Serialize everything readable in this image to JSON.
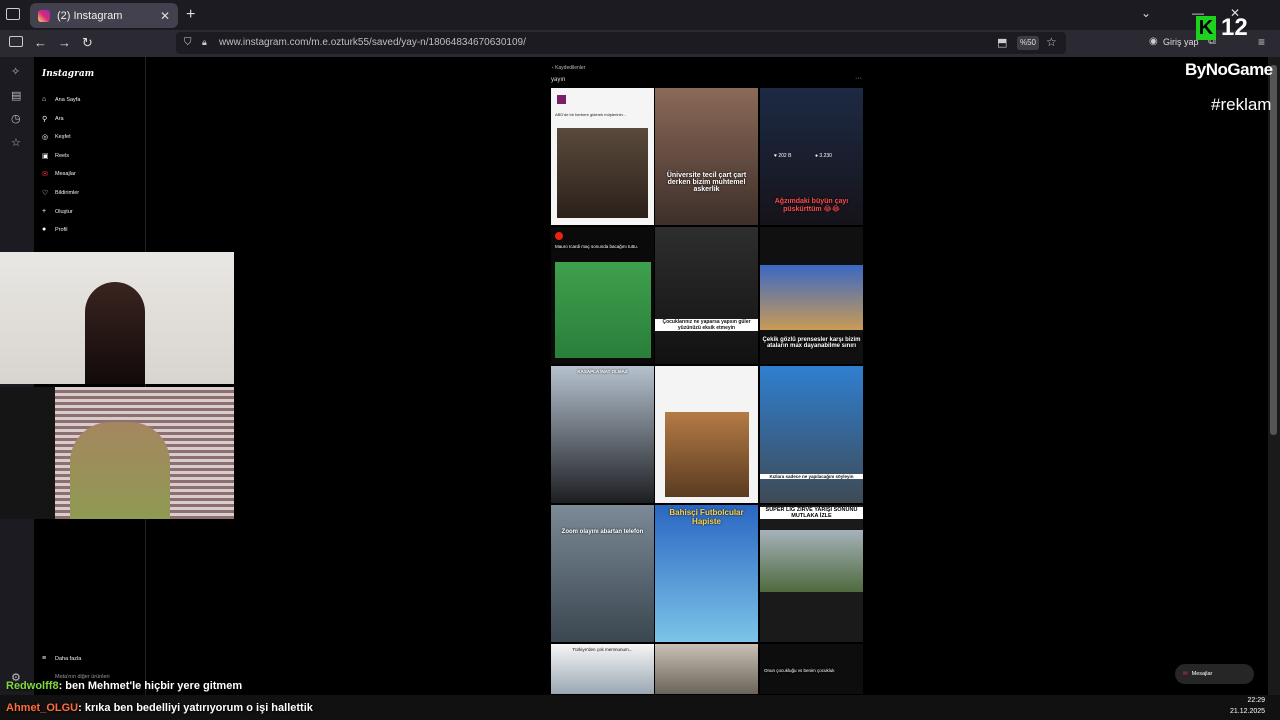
{
  "browser": {
    "tab_title": "(2) Instagram",
    "url": "www.instagram.com/m.e.ozturk55/saved/yay-n/18064834670630109/",
    "zoom": "%50",
    "login": "Giriş yap"
  },
  "instagram": {
    "logo": "Instagram",
    "nav": [
      {
        "icon": "home-icon",
        "label": "Ana Sayfa"
      },
      {
        "icon": "search-icon",
        "label": "Ara"
      },
      {
        "icon": "compass-icon",
        "label": "Keşfet"
      },
      {
        "icon": "reels-icon",
        "label": "Reels"
      },
      {
        "icon": "messages-icon",
        "label": "Mesajlar"
      },
      {
        "icon": "heart-icon",
        "label": "Bildirimler"
      },
      {
        "icon": "plus-icon",
        "label": "Oluştur"
      },
      {
        "icon": "profile-icon",
        "label": "Profil"
      }
    ],
    "more_label": "Daha fazla",
    "meta_label": "Meta'nın diğer ürünleri",
    "back_label": "Kaydedilenler",
    "collection_title": "yayın",
    "messages_button": "Mesajlar",
    "tiles": [
      {
        "caption": "ABD'de bir berbere giderek müşterinin..."
      },
      {
        "caption": "Üniversite tecil çart çart derken bizim muhtemel askerlik"
      },
      {
        "caption": "Ağzımdaki büyün çayı püskürttüm 😂😂",
        "stat1": "202 B",
        "stat2": "3.230"
      },
      {
        "caption": "Mauro Icardi maç sonunda bacağını tuttu."
      },
      {
        "caption": "Çocuklarınız ne yaparsa yapsın güler yüzünüzü eksik etmeyin"
      },
      {
        "caption": "Çekik gözlü prensesler karşı bizim ataların max dayanabilme sınırı"
      },
      {
        "caption": "KASAPLA İNAT OLMAZ"
      },
      {
        "caption": ""
      },
      {
        "caption": "Kızlara sadece ne yapılacağını söyleyin"
      },
      {
        "caption": "Zoom olayını abartan telefon"
      },
      {
        "caption": "Bahisçi Futbolcular Hapiste"
      },
      {
        "caption": "SÜPER LİG ZİRVE YARIŞI SONUNU MUTLAKA İZLE"
      },
      {
        "caption": "Türkiye'den çok memnunum..."
      },
      {
        "caption": ""
      },
      {
        "caption": "Onun çocukluğu vs benim çocukluk"
      }
    ]
  },
  "overlay": {
    "channel_number": "12",
    "brand": "ByNoGame",
    "ad_tag": "#reklam",
    "chat": [
      {
        "user": "Redwolff8",
        "text": ": ben Mehmet'le hiçbir yere gitmem"
      },
      {
        "user": "Ahmet_OLGU",
        "text": ": krıka ben bedelliyi yatırıyorum o işi hallettik"
      }
    ],
    "time": "22:29",
    "date": "21.12.2025"
  }
}
